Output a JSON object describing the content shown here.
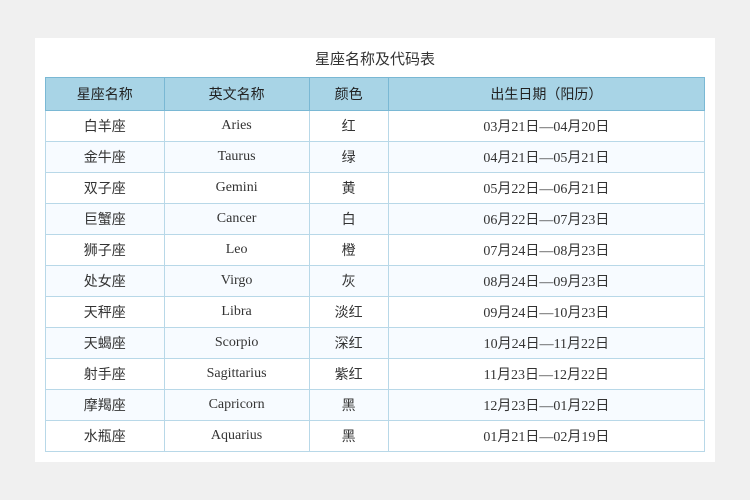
{
  "title": "星座名称及代码表",
  "headers": {
    "name": "星座名称",
    "english": "英文名称",
    "color": "颜色",
    "birthday": "出生日期（阳历）"
  },
  "rows": [
    {
      "name": "白羊座",
      "english": "Aries",
      "color": "红",
      "date": "03月21日—04月20日"
    },
    {
      "name": "金牛座",
      "english": "Taurus",
      "color": "绿",
      "date": "04月21日—05月21日"
    },
    {
      "name": "双子座",
      "english": "Gemini",
      "color": "黄",
      "date": "05月22日—06月21日"
    },
    {
      "name": "巨蟹座",
      "english": "Cancer",
      "color": "白",
      "date": "06月22日—07月23日"
    },
    {
      "name": "狮子座",
      "english": "Leo",
      "color": "橙",
      "date": "07月24日—08月23日"
    },
    {
      "name": "处女座",
      "english": "Virgo",
      "color": "灰",
      "date": "08月24日—09月23日"
    },
    {
      "name": "天秤座",
      "english": "Libra",
      "color": "淡红",
      "date": "09月24日—10月23日"
    },
    {
      "name": "天蝎座",
      "english": "Scorpio",
      "color": "深红",
      "date": "10月24日—11月22日"
    },
    {
      "name": "射手座",
      "english": "Sagittarius",
      "color": "紫红",
      "date": "11月23日—12月22日"
    },
    {
      "name": "摩羯座",
      "english": "Capricorn",
      "color": "黑",
      "date": "12月23日—01月22日"
    },
    {
      "name": "水瓶座",
      "english": "Aquarius",
      "color": "黑",
      "date": "01月21日—02月19日"
    }
  ]
}
